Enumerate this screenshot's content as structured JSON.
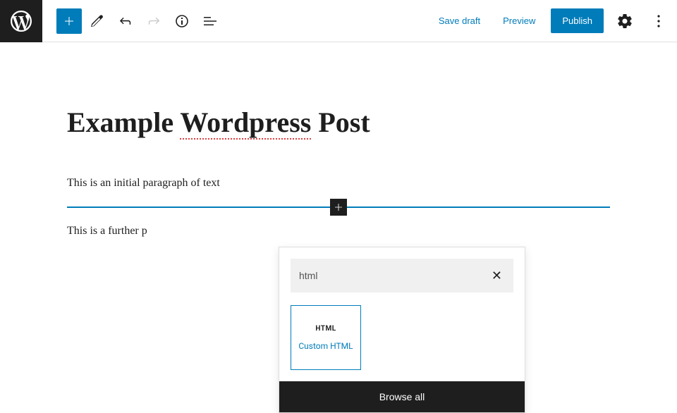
{
  "topbar": {
    "save_draft": "Save draft",
    "preview": "Preview",
    "publish": "Publish"
  },
  "editor": {
    "title_parts": [
      "Example ",
      "Wordpress",
      " Post"
    ],
    "paragraph1": "This is an initial paragraph of text",
    "paragraph2_visible": "This is a further p"
  },
  "inserter": {
    "search_value": "html",
    "block_icon_text": "HTML",
    "block_label": "Custom HTML",
    "browse_all": "Browse all"
  }
}
